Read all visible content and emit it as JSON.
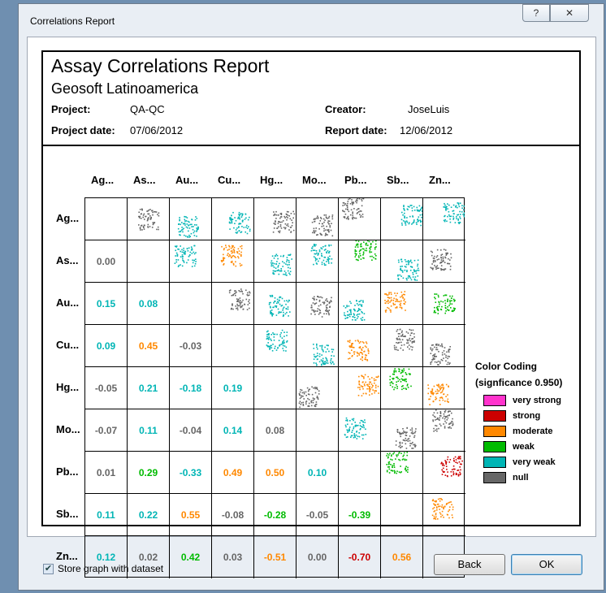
{
  "window": {
    "title": "Correlations Report",
    "help_glyph": "?",
    "close_glyph": "✕"
  },
  "report": {
    "title": "Assay Correlations Report",
    "subtitle": "Geosoft Latinoamerica",
    "project_label": "Project:",
    "project": "QA-QC",
    "creator_label": "Creator:",
    "creator": "JoseLuis",
    "project_date_label": "Project date:",
    "project_date": "07/06/2012",
    "report_date_label": "Report date:",
    "report_date": "12/06/2012"
  },
  "matrix": {
    "labels": [
      "Ag...",
      "As...",
      "Au...",
      "Cu...",
      "Hg...",
      "Mo...",
      "Pb...",
      "Sb...",
      "Zn..."
    ],
    "lower": [
      [],
      [
        {
          "v": "0.00",
          "c": "null"
        }
      ],
      [
        {
          "v": "0.15",
          "c": "very_weak"
        },
        {
          "v": "0.08",
          "c": "very_weak"
        }
      ],
      [
        {
          "v": "0.09",
          "c": "very_weak"
        },
        {
          "v": "0.45",
          "c": "moderate"
        },
        {
          "v": "-0.03",
          "c": "null"
        }
      ],
      [
        {
          "v": "-0.05",
          "c": "null"
        },
        {
          "v": "0.21",
          "c": "very_weak"
        },
        {
          "v": "-0.18",
          "c": "very_weak"
        },
        {
          "v": "0.19",
          "c": "very_weak"
        }
      ],
      [
        {
          "v": "-0.07",
          "c": "null"
        },
        {
          "v": "0.11",
          "c": "very_weak"
        },
        {
          "v": "-0.04",
          "c": "null"
        },
        {
          "v": "0.14",
          "c": "very_weak"
        },
        {
          "v": "0.08",
          "c": "null"
        }
      ],
      [
        {
          "v": "0.01",
          "c": "null"
        },
        {
          "v": "0.29",
          "c": "weak"
        },
        {
          "v": "-0.33",
          "c": "very_weak"
        },
        {
          "v": "0.49",
          "c": "moderate"
        },
        {
          "v": "0.50",
          "c": "moderate"
        },
        {
          "v": "0.10",
          "c": "very_weak"
        }
      ],
      [
        {
          "v": "0.11",
          "c": "very_weak"
        },
        {
          "v": "0.22",
          "c": "very_weak"
        },
        {
          "v": "0.55",
          "c": "moderate"
        },
        {
          "v": "-0.08",
          "c": "null"
        },
        {
          "v": "-0.28",
          "c": "weak"
        },
        {
          "v": "-0.05",
          "c": "null"
        },
        {
          "v": "-0.39",
          "c": "weak"
        }
      ],
      [
        {
          "v": "0.12",
          "c": "very_weak"
        },
        {
          "v": "0.02",
          "c": "null"
        },
        {
          "v": "0.42",
          "c": "weak"
        },
        {
          "v": "0.03",
          "c": "null"
        },
        {
          "v": "-0.51",
          "c": "moderate"
        },
        {
          "v": "0.00",
          "c": "null"
        },
        {
          "v": "-0.70",
          "c": "strong"
        },
        {
          "v": "0.56",
          "c": "moderate"
        }
      ]
    ]
  },
  "colors": {
    "very_strong": "#ff33cc",
    "strong": "#cc0000",
    "moderate": "#ff8800",
    "weak": "#00bb00",
    "very_weak": "#00b5b5",
    "null": "#666666"
  },
  "legend": {
    "title": "Color Coding",
    "subtitle": "(signficance 0.950)",
    "items": [
      {
        "key": "very_strong",
        "label": "very strong"
      },
      {
        "key": "strong",
        "label": "strong"
      },
      {
        "key": "moderate",
        "label": "moderate"
      },
      {
        "key": "weak",
        "label": "weak"
      },
      {
        "key": "very_weak",
        "label": "very weak"
      },
      {
        "key": "null",
        "label": "null"
      }
    ]
  },
  "footer": {
    "store_checked": true,
    "store_label": "Store graph with dataset",
    "back_label": "Back",
    "ok_label": "OK"
  }
}
